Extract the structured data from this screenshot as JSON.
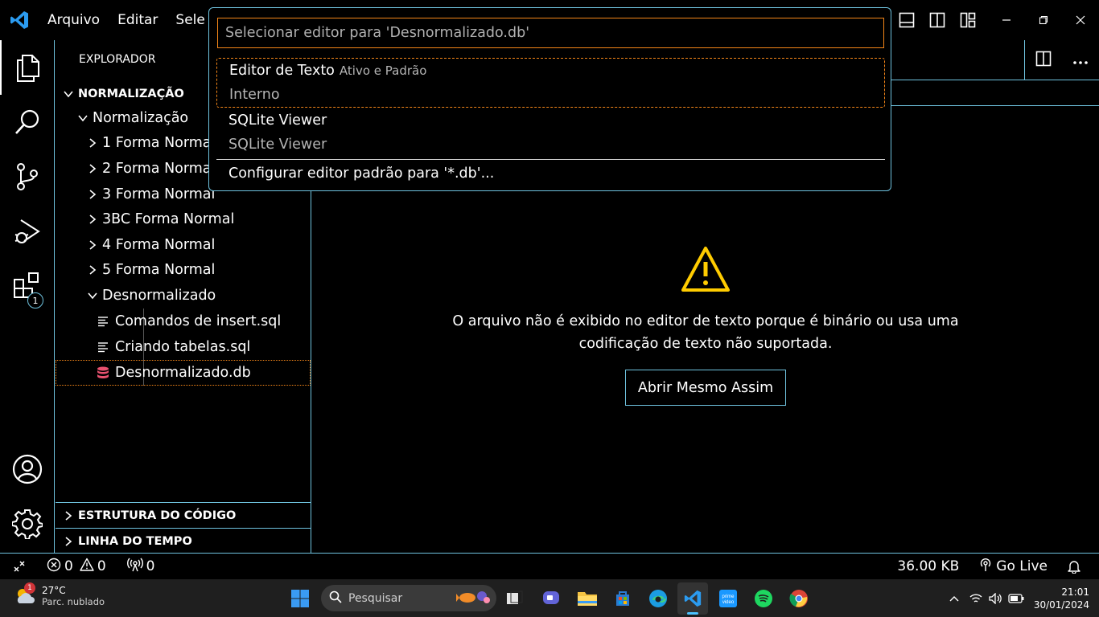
{
  "menu": [
    "Arquivo",
    "Editar",
    "Sele"
  ],
  "explorer": {
    "title": "EXPLORADOR",
    "root": "NORMALIZAÇÃO",
    "folder": "Normalização",
    "children": [
      "1 Forma Normal",
      "2 Forma Normal",
      "3 Forma Normal",
      "3BC Forma Normal",
      "4 Forma Normal",
      "5 Forma Normal"
    ],
    "open_folder": "Desnormalizado",
    "files": [
      "Comandos de insert.sql",
      "Criando tabelas.sql",
      "Desnormalizado.db"
    ],
    "panels": [
      "ESTRUTURA DO CÓDIGO",
      "LINHA DO TEMPO"
    ]
  },
  "activity": {
    "extensions_badge": "1"
  },
  "quickpick": {
    "placeholder": "Selecionar editor para 'Desnormalizado.db'",
    "items": [
      {
        "label": "Editor de Texto",
        "description": "Ativo e Padrão",
        "detail": "Interno"
      },
      {
        "label": "SQLite Viewer",
        "description": "",
        "detail": "SQLite Viewer"
      }
    ],
    "configure": "Configurar editor padrão para '*.db'..."
  },
  "editor": {
    "message_line1": "O arquivo não é exibido no editor de texto porque é binário ou usa uma",
    "message_line2": "codificação de texto não suportada.",
    "open_anyway": "Abrir Mesmo Assim"
  },
  "status": {
    "errors": "0",
    "warnings": "0",
    "ports": "0",
    "file_size": "36.00 KB",
    "go_live": "Go Live"
  },
  "taskbar": {
    "weather_temp": "27°C",
    "weather_desc": "Parc. nublado",
    "weather_badge": "1",
    "search": "Pesquisar",
    "time": "21:01",
    "date": "30/01/2024"
  },
  "colors": {
    "accent_border": "#6fc3df",
    "focus_border": "#f38518",
    "warning": "#ffcc00",
    "db_icon": "#e8516f"
  }
}
